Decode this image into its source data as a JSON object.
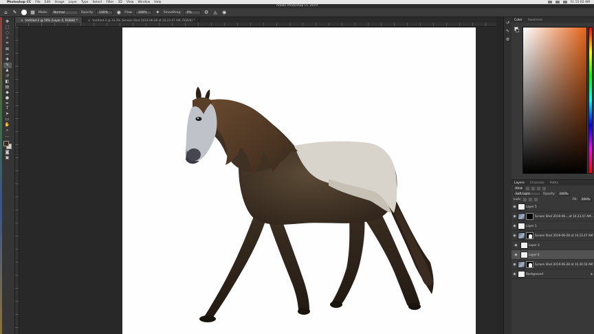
{
  "menubar": {
    "app_name": "Photoshop CC",
    "items": [
      "File",
      "Edit",
      "Image",
      "Layer",
      "Type",
      "Select",
      "Filter",
      "3D",
      "View",
      "Window",
      "Help"
    ],
    "clock": "Fri 11:02 AM"
  },
  "window": {
    "title": "Adobe Photoshop CC 2019"
  },
  "options": {
    "mode_label": "Mode:",
    "mode_value": "Normal",
    "opacity_label": "Opacity:",
    "opacity_value": "100%",
    "flow_label": "Flow:",
    "flow_value": "100%",
    "smoothing_label": "Smoothing:",
    "smoothing_value": "0%"
  },
  "tabs": [
    {
      "label": "Untitled-2 @ 50% (Layer 4, RGB/8) *"
    },
    {
      "label": "Untitled-3 @ 33.3% (Screen Shot 2019-06-28 at 10.23.47 AM, RGB/8) *"
    }
  ],
  "panels": {
    "color_tabs": [
      "Color",
      "Swatches"
    ],
    "layer_tabs": [
      "Layers",
      "Channels",
      "Paths"
    ],
    "kind_label": "Kind",
    "blend_value": "Soft Light",
    "opacity_label": "Opacity:",
    "opacity_value": "100%",
    "lock_label": "Lock:",
    "fill_label": "Fill:",
    "fill_value": "100%"
  },
  "layers": [
    {
      "name": "Layer 5",
      "thumb": "blank",
      "mask": false
    },
    {
      "name": "Screen Shot 2019-06-...at 10.23.47 AM copy",
      "thumb": "image",
      "mask": true
    },
    {
      "name": "Layer 1",
      "thumb": "blank",
      "mask": false
    },
    {
      "name": "Screen Shot 2019-06-28 at 10.23.47 AM",
      "thumb": "image",
      "mask": "horse"
    },
    {
      "name": "Layer 3",
      "thumb": "blank",
      "mask": false
    },
    {
      "name": "Layer 4",
      "thumb": "blank",
      "mask": false,
      "selected": true
    },
    {
      "name": "Screen Shot 2019-06-28 at 10.30.50 AM",
      "thumb": "image",
      "mask": "horse"
    },
    {
      "name": "Background",
      "thumb": "blank",
      "mask": false
    }
  ],
  "colors": {
    "foreground": "#3a2b1f",
    "background": "#d9d2c6",
    "picker_hue": "#e3641a"
  }
}
